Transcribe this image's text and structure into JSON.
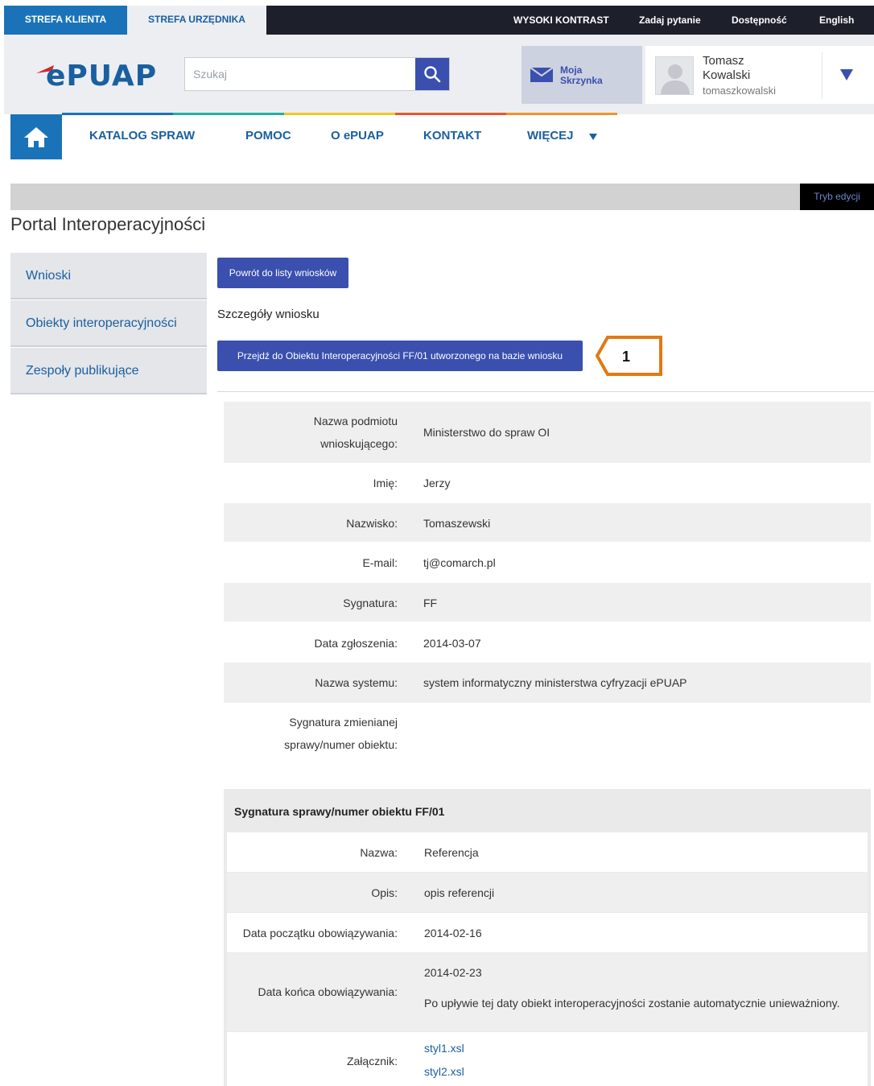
{
  "topbar": {
    "zone_client": "STREFA KLIENTA",
    "zone_clerk": "STREFA URZĘDNIKA",
    "high_contrast": "WYSOKI KONTRAST",
    "ask_question": "Zadaj pytanie",
    "accessibility": "Dostępność",
    "language": "English"
  },
  "header": {
    "logo": "ePUAP",
    "search_placeholder": "Szukaj",
    "mailbox_line1": "Moja",
    "mailbox_line2": "Skrzynka",
    "user_first": "Tomasz",
    "user_last": "Kowalski",
    "user_login": "tomaszkowalski"
  },
  "nav": {
    "items": [
      "KATALOG SPRAW",
      "POMOC",
      "O ePUAP",
      "KONTAKT",
      "WIĘCEJ"
    ],
    "stripe_colors": [
      "#1a73b8",
      "#1fb0a0",
      "#f3c623",
      "#e25a2f",
      "#f0932b"
    ]
  },
  "edit_mode": "Tryb edycji",
  "page_title": "Portal Interoperacyjności",
  "sidebar": {
    "items": [
      "Wnioski",
      "Obiekty interoperacyjności",
      "Zespoły publikujące"
    ]
  },
  "main": {
    "back_button": "Powrót do listy wniosków",
    "section_title": "Szczegóły wniosku",
    "goto_button": "Przejdź do Obiektu Interoperacyjności FF/01 utworzonego na bazie wniosku",
    "marker_number": "1",
    "details": {
      "applicant_label_1": "Nazwa podmiotu",
      "applicant_label_2": "wnioskującego:",
      "applicant_value": "Ministerstwo do spraw OI",
      "first_name_label": "Imię:",
      "first_name_value": "Jerzy",
      "last_name_label": "Nazwisko:",
      "last_name_value": "Tomaszewski",
      "email_label": "E-mail:",
      "email_value": "tj@comarch.pl",
      "signature_label": "Sygnatura:",
      "signature_value": "FF",
      "date_label": "Data zgłoszenia:",
      "date_value": "2014-03-07",
      "system_label": "Nazwa systemu:",
      "system_value": "system informatyczny ministerstwa cyfryzacji ePUAP",
      "changed_label_1": "Sygnatura zmienianej",
      "changed_label_2": "sprawy/numer obiektu:"
    },
    "object": {
      "title": "Sygnatura sprawy/numer obiektu FF/01",
      "name_label": "Nazwa:",
      "name_value": "Referencja",
      "desc_label": "Opis:",
      "desc_value": "opis referencji",
      "start_label": "Data początku obowiązywania:",
      "start_value": "2014-02-16",
      "end_label": "Data końca obowiązywania:",
      "end_value": "2014-02-23",
      "end_note": "Po upływie tej daty obiekt interoperacyjności zostanie automatycznie unieważniony.",
      "attachment_label": "Załącznik:",
      "attachments": [
        "styl1.xsl",
        "styl2.xsl"
      ]
    }
  },
  "colors": {
    "primary_blue": "#3a4fae",
    "zone_blue": "#1a73b8",
    "marker_orange": "#e07a12"
  }
}
